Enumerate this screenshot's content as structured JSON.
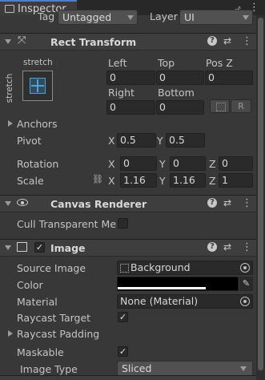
{
  "tab": {
    "title": "Inspector"
  },
  "top": {
    "tag_label": "Tag",
    "tag_value": "Untagged",
    "layer_label": "Layer",
    "layer_value": "UI"
  },
  "rect_transform": {
    "title": "Rect Transform",
    "anchor_preset_top": "stretch",
    "anchor_preset_side": "stretch",
    "left_label": "Left",
    "left_value": "0",
    "top_label": "Top",
    "top_value": "0",
    "posz_label": "Pos Z",
    "posz_value": "0",
    "right_label": "Right",
    "right_value": "0",
    "bottom_label": "Bottom",
    "bottom_value": "0",
    "raw_button": "R",
    "anchors_label": "Anchors",
    "pivot_label": "Pivot",
    "pivot_x": "0.5",
    "pivot_y": "0.5",
    "rotation_label": "Rotation",
    "rot_x": "0",
    "rot_y": "0",
    "rot_z": "0",
    "scale_label": "Scale",
    "scale_x": "1.16",
    "scale_y": "1.16",
    "scale_z": "1",
    "x": "X",
    "y": "Y",
    "z": "Z"
  },
  "canvas_renderer": {
    "title": "Canvas Renderer",
    "cull_label": "Cull Transparent Mes"
  },
  "image": {
    "title": "Image",
    "source_label": "Source Image",
    "source_value": "Background",
    "color_label": "Color",
    "material_label": "Material",
    "material_value": "None (Material)",
    "raycast_target_label": "Raycast Target",
    "raycast_padding_label": "Raycast Padding",
    "maskable_label": "Maskable",
    "image_type_label": "Image Type",
    "image_type_value": "Sliced"
  },
  "colors": {
    "accent": "#4c7fd1",
    "background": "#383838",
    "field": "#2a2a2a",
    "anchor_blue": "#4aa3df"
  }
}
